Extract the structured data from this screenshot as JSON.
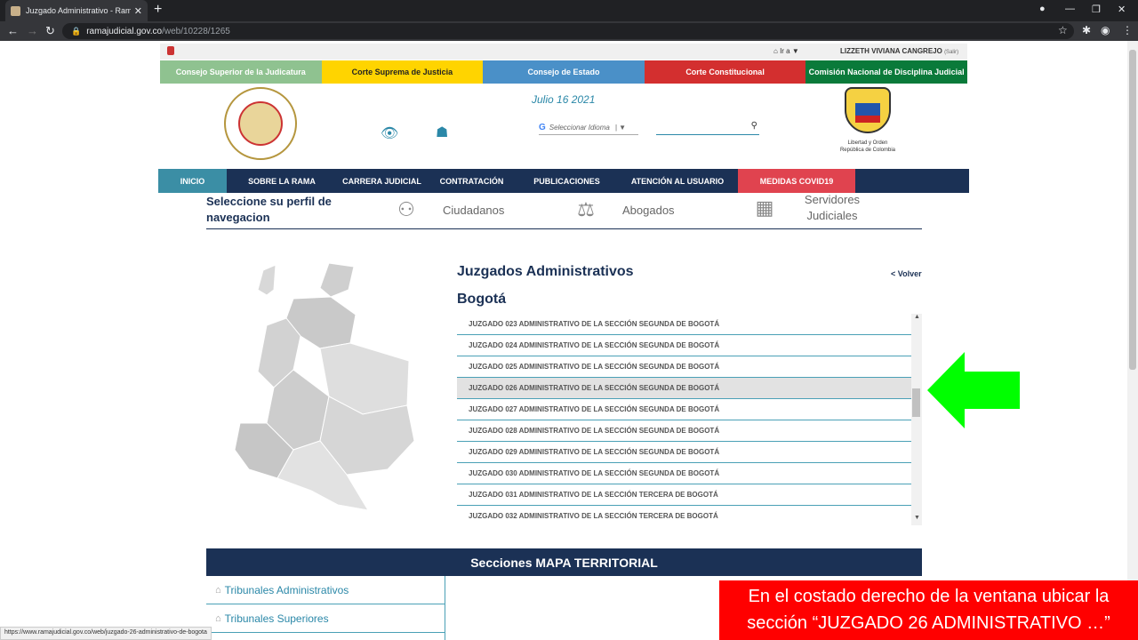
{
  "browser": {
    "tab_title": "Juzgado Administrativo - Rama J",
    "tab_close": "✕",
    "new_tab": "+",
    "url_host": "ramajudicial.gov.co",
    "url_path": "/web/10228/1265"
  },
  "userbar": {
    "ira": "Ir a ▼",
    "user": "LIZZETH VIVIANA CANGREJO",
    "salir": "(Salir)"
  },
  "topnav": [
    {
      "label": "Consejo Superior de la Judicatura",
      "color": "#8fc290"
    },
    {
      "label": "Corte Suprema de Justicia",
      "color": "#ffd400"
    },
    {
      "label": "Consejo de Estado",
      "color": "#4a90c8"
    },
    {
      "label": "Corte Constitucional",
      "color": "#d32f2f"
    },
    {
      "label": "Comisión Nacional de Disciplina Judicial",
      "color": "#0a7a3a"
    }
  ],
  "header": {
    "date": "Julio 16 2021",
    "lang_placeholder": "Seleccionar Idioma",
    "seal_text": "RAMA JUDICIAL REPÚBLICA DE COLOMBIA",
    "shield_caption_1": "Libertad y Orden",
    "shield_caption_2": "República de Colombia"
  },
  "mainnav": [
    {
      "label": "INICIO",
      "color": "#3b8ea5"
    },
    {
      "label": "SOBRE LA RAMA",
      "color": "#1b3155"
    },
    {
      "label": "CARRERA JUDICIAL",
      "color": "#1b3155"
    },
    {
      "label": "CONTRATACIÓN",
      "color": "#1b3155"
    },
    {
      "label": "PUBLICACIONES",
      "color": "#1b3155"
    },
    {
      "label": "ATENCIÓN AL USUARIO",
      "color": "#1b3155"
    },
    {
      "label": "MEDIDAS COVID19",
      "color": "#e0434f"
    }
  ],
  "profile": {
    "prompt": "Seleccione su perfil de navegacion",
    "options": [
      "Ciudadanos",
      "Abogados",
      "Servidores Judiciales"
    ]
  },
  "main": {
    "title": "Juzgados Administrativos",
    "back": "< Volver",
    "city": "Bogotá",
    "rows": [
      "JUZGADO 023 ADMINISTRATIVO DE LA SECCIÓN SEGUNDA DE BOGOTÁ",
      "JUZGADO 024 ADMINISTRATIVO DE LA SECCIÓN SEGUNDA DE BOGOTÁ",
      "JUZGADO 025 ADMINISTRATIVO DE LA SECCIÓN SEGUNDA DE BOGOTÁ",
      "JUZGADO 026 ADMINISTRATIVO DE LA SECCIÓN SEGUNDA DE BOGOTÁ",
      "JUZGADO 027 ADMINISTRATIVO DE LA SECCIÓN SEGUNDA DE BOGOTÁ",
      "JUZGADO 028 ADMINISTRATIVO DE LA SECCIÓN SEGUNDA DE BOGOTÁ",
      "JUZGADO 029 ADMINISTRATIVO DE LA SECCIÓN SEGUNDA DE BOGOTÁ",
      "JUZGADO 030 ADMINISTRATIVO DE LA SECCIÓN SEGUNDA DE BOGOTÁ",
      "JUZGADO 031 ADMINISTRATIVO DE LA SECCIÓN TERCERA DE BOGOTÁ",
      "JUZGADO 032 ADMINISTRATIVO DE LA SECCIÓN TERCERA DE BOGOTÁ"
    ],
    "highlighted_index": 3
  },
  "sections": {
    "title": "Secciones MAPA TERRITORIAL",
    "items": [
      "Tribunales Administrativos",
      "Tribunales Superiores"
    ]
  },
  "statusbar": "https://www.ramajudicial.gov.co/web/juzgado-26-administrativo-de-bogota",
  "callout": "En el costado derecho de la ventana ubicar la sección “JUZGADO 26 ADMINISTRATIVO …”",
  "arrow_color": "#00ff00"
}
